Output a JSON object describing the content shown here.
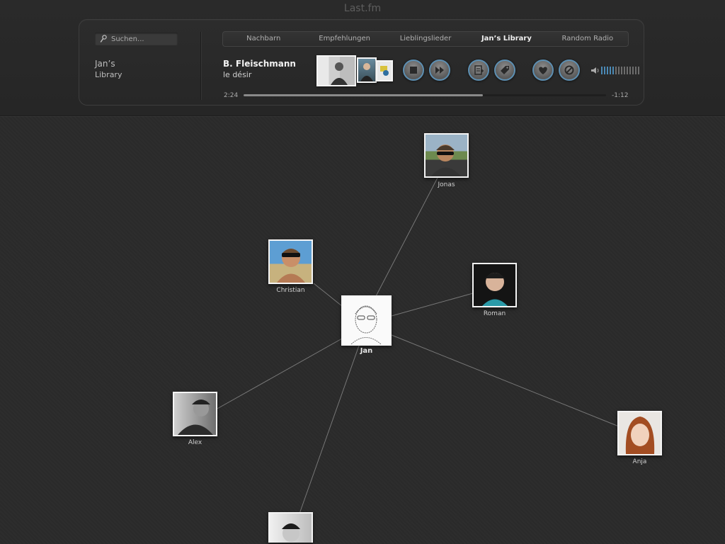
{
  "app": {
    "title": "Last.fm"
  },
  "search": {
    "placeholder": "Suchen..."
  },
  "library": {
    "owner": "Jan’s",
    "label": "Library"
  },
  "tabs": [
    {
      "label": "Nachbarn",
      "active": false
    },
    {
      "label": "Empfehlungen",
      "active": false
    },
    {
      "label": "Lieblingslieder",
      "active": false
    },
    {
      "label": "Jan’s Library",
      "active": true
    },
    {
      "label": "Random Radio",
      "active": false
    }
  ],
  "track": {
    "artist": "B. Fleischmann",
    "title": "le désir"
  },
  "controls": [
    {
      "name": "stop-button",
      "icon": "stop-icon"
    },
    {
      "name": "skip-button",
      "icon": "fast-forward-icon"
    },
    {
      "name": "add-to-playlist-button",
      "icon": "playlist-add-icon"
    },
    {
      "name": "tag-button",
      "icon": "tag-icon"
    },
    {
      "name": "love-button",
      "icon": "heart-icon"
    },
    {
      "name": "ban-button",
      "icon": "ban-icon"
    }
  ],
  "volume": {
    "level": 0.35,
    "bars": 14,
    "icon": "speaker-icon"
  },
  "progress": {
    "elapsed": "2:24",
    "remaining": "-1:12",
    "fraction": 0.66
  },
  "colors": {
    "accent": "#4b8ab6",
    "background": "#2b2b2b",
    "line": "#7a7a7a"
  },
  "friends": [
    {
      "id": "jan",
      "name": "Jan",
      "center": true
    },
    {
      "id": "jonas",
      "name": "Jonas"
    },
    {
      "id": "christian",
      "name": "Christian"
    },
    {
      "id": "roman",
      "name": "Roman"
    },
    {
      "id": "alex",
      "name": "Alex"
    },
    {
      "id": "anja",
      "name": "Anja"
    },
    {
      "id": "unnamed",
      "name": ""
    }
  ]
}
